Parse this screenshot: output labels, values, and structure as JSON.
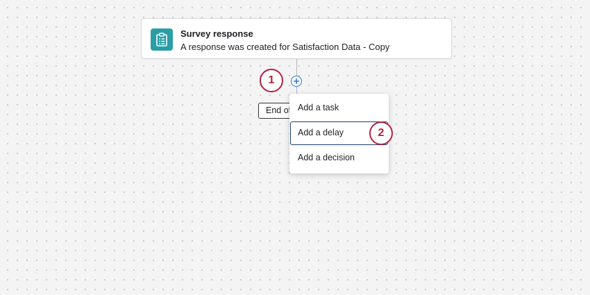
{
  "trigger": {
    "title": "Survey response",
    "subtitle": "A response was created for Satisfaction Data - Copy",
    "icon": "clipboard-list-icon"
  },
  "end_node": {
    "label": "End of"
  },
  "add_step": {
    "icon": "plus-circle-icon"
  },
  "menu": {
    "items": [
      {
        "label": "Add a task"
      },
      {
        "label": "Add a delay"
      },
      {
        "label": "Add a decision"
      }
    ]
  },
  "callouts": [
    "1",
    "2"
  ],
  "colors": {
    "accent_teal": "#2a9ea6",
    "callout_red": "#b0233d",
    "add_blue": "#2770d0",
    "focus_navy": "#1d3a6e"
  }
}
